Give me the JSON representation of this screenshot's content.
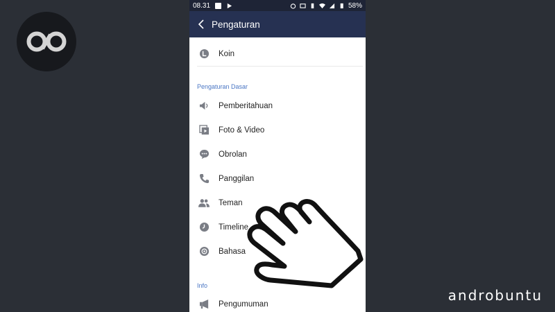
{
  "status_bar": {
    "time": "08.31",
    "battery": "58%"
  },
  "header": {
    "title": "Pengaturan",
    "back_icon": "chevron-left-icon"
  },
  "items_top": [
    {
      "label": "Koin",
      "icon": "coin-icon"
    }
  ],
  "section_basic": {
    "title": "Pengaturan Dasar",
    "items": [
      {
        "label": "Pemberitahuan",
        "icon": "speaker-icon"
      },
      {
        "label": "Foto & Video",
        "icon": "photo-video-icon"
      },
      {
        "label": "Obrolan",
        "icon": "chat-icon"
      },
      {
        "label": "Panggilan",
        "icon": "phone-icon"
      },
      {
        "label": "Teman",
        "icon": "friends-icon"
      },
      {
        "label": "Timeline",
        "icon": "clock-icon"
      },
      {
        "label": "Bahasa",
        "icon": "globe-icon"
      }
    ]
  },
  "section_info": {
    "title": "Info",
    "items": [
      {
        "label": "Pengumuman",
        "icon": "megaphone-icon"
      }
    ]
  },
  "watermark": "androbuntu",
  "colors": {
    "header_bg": "#263152",
    "section_title": "#4a76c4",
    "icon": "#7a7d85",
    "background": "#2b2f36"
  }
}
